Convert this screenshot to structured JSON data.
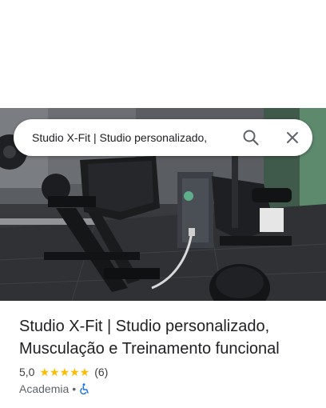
{
  "search": {
    "query": "Studio X-Fit | Studio personalizado,",
    "search_icon": "search-icon",
    "close_icon": "close-icon"
  },
  "place": {
    "name": "Studio X-Fit | Studio personalizado, Musculação e Treinamento funcional",
    "rating": "5,0",
    "rating_value": 5.0,
    "stars": "★★★★★",
    "reviews": "(6)",
    "category": "Academia",
    "separator": "•",
    "accessibility_icon": "wheelchair-icon"
  },
  "colors": {
    "star": "#fbbc04",
    "text_primary": "#202124",
    "text_secondary": "#5f6368",
    "accessibility_blue": "#1a73e8"
  }
}
